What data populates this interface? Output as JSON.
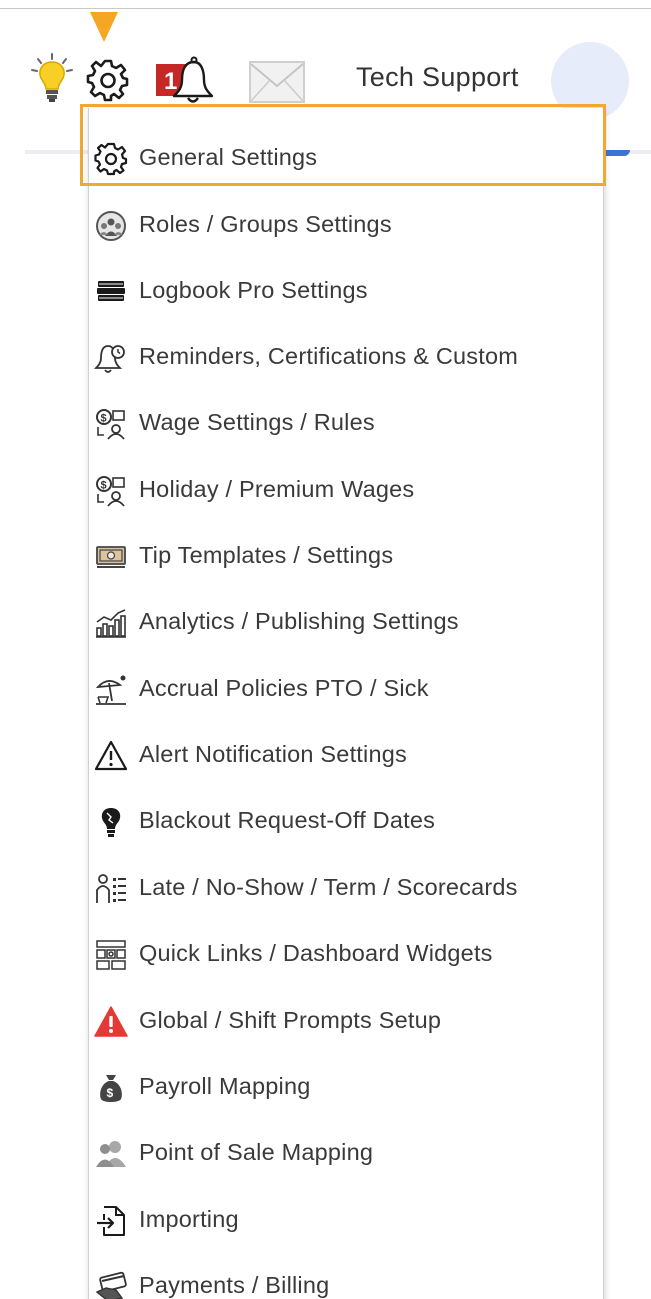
{
  "header": {
    "tech_support_label": "Tech Support",
    "notification_count": "1",
    "icons": [
      "lightbulb-icon",
      "settings-gear-icon",
      "notification-bell-icon",
      "mail-icon",
      "user-avatar"
    ]
  },
  "colors": {
    "accent_orange": "#f5a623",
    "notification_red": "#c62828",
    "alert_red": "#e53935",
    "text": "#3a3a3a",
    "link_blue": "#3a74d8"
  },
  "settings_menu": {
    "items": [
      {
        "label": "General Settings",
        "icon": "gear-icon",
        "active": true
      },
      {
        "label": "Roles / Groups Settings",
        "icon": "roles-groups-icon"
      },
      {
        "label": "Logbook Pro Settings",
        "icon": "logbook-icon"
      },
      {
        "label": "Reminders, Certifications & Custom",
        "icon": "reminder-bell-icon"
      },
      {
        "label": "Wage Settings / Rules",
        "icon": "wage-icon"
      },
      {
        "label": "Holiday / Premium Wages",
        "icon": "holiday-wage-icon"
      },
      {
        "label": "Tip Templates / Settings",
        "icon": "tip-money-icon"
      },
      {
        "label": "Analytics / Publishing Settings",
        "icon": "analytics-chart-icon"
      },
      {
        "label": "Accrual Policies PTO / Sick",
        "icon": "beach-umbrella-icon"
      },
      {
        "label": "Alert Notification Settings",
        "icon": "warning-triangle-icon"
      },
      {
        "label": "Blackout Request-Off Dates",
        "icon": "blackout-bulb-icon"
      },
      {
        "label": "Late / No-Show / Term / Scorecards",
        "icon": "scorecard-icon"
      },
      {
        "label": "Quick Links / Dashboard Widgets",
        "icon": "dashboard-widgets-icon"
      },
      {
        "label": "Global / Shift Prompts Setup",
        "icon": "alert-triangle-red-icon"
      },
      {
        "label": "Payroll Mapping",
        "icon": "money-bag-icon"
      },
      {
        "label": "Point of Sale Mapping",
        "icon": "people-icon"
      },
      {
        "label": "Importing",
        "icon": "import-file-icon"
      },
      {
        "label": "Payments / Billing",
        "icon": "payment-card-icon"
      }
    ]
  }
}
